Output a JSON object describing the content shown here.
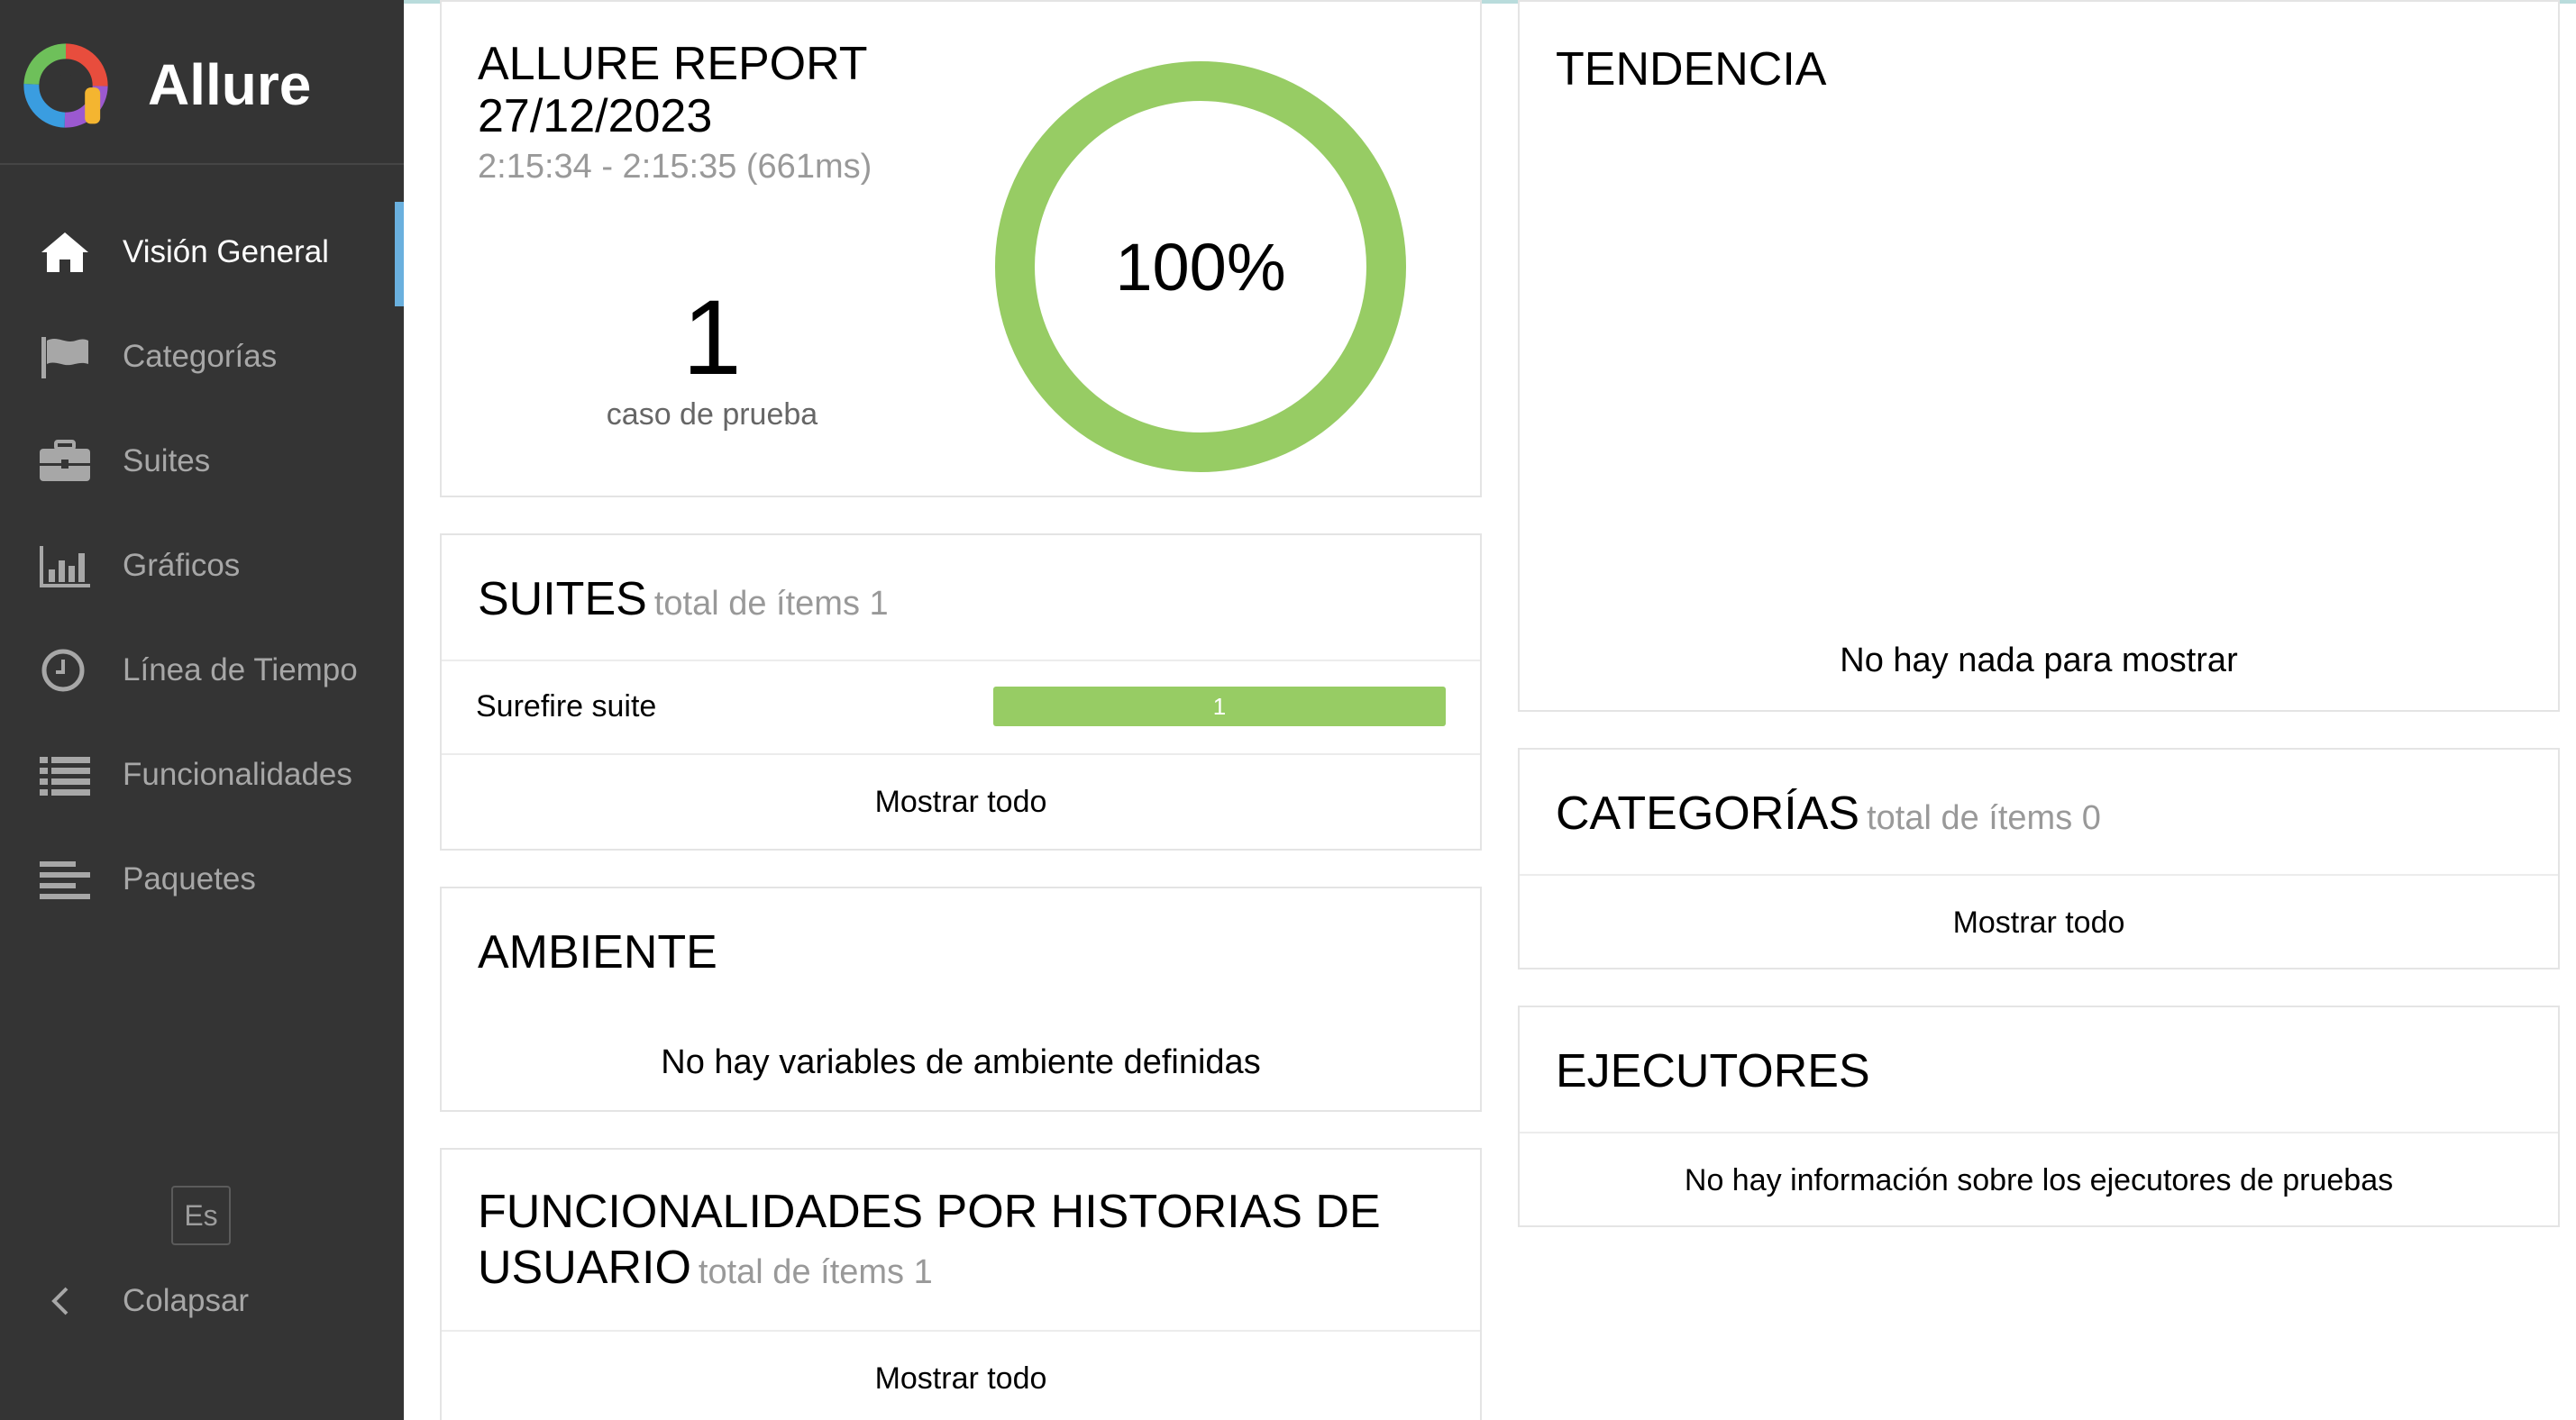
{
  "app": {
    "name": "Allure"
  },
  "sidebar": {
    "items": [
      {
        "label": "Visión General",
        "icon": "home-icon",
        "active": true
      },
      {
        "label": "Categorías",
        "icon": "flag-icon"
      },
      {
        "label": "Suites",
        "icon": "briefcase-icon"
      },
      {
        "label": "Gráficos",
        "icon": "bar-chart-icon"
      },
      {
        "label": "Línea de Tiempo",
        "icon": "clock-icon"
      },
      {
        "label": "Funcionalidades",
        "icon": "list-icon"
      },
      {
        "label": "Paquetes",
        "icon": "align-left-icon"
      }
    ],
    "language": "Es",
    "collapse_label": "Colapsar"
  },
  "report": {
    "title": "ALLURE REPORT",
    "date": "27/12/2023",
    "time_range": "2:15:34 - 2:15:35 (661ms)",
    "test_case_count": "1",
    "test_case_label": "caso de prueba",
    "success_rate": "100%",
    "success_fraction": 1.0
  },
  "trend": {
    "title": "TENDENCIA",
    "empty_text": "No hay nada para mostrar"
  },
  "suites": {
    "title": "SUITES",
    "subtitle": "total de ítems 1",
    "rows": [
      {
        "name": "Surefire suite",
        "count": "1"
      }
    ],
    "show_all": "Mostrar todo"
  },
  "categories": {
    "title": "CATEGORÍAS",
    "subtitle": "total de ítems 0",
    "show_all": "Mostrar todo"
  },
  "environment": {
    "title": "AMBIENTE",
    "empty_text": "No hay variables de ambiente definidas"
  },
  "executors": {
    "title": "EJECUTORES",
    "empty_text": "No hay información sobre los ejecutores de pruebas"
  },
  "features": {
    "title_line1": "FUNCIONALIDADES POR HISTORIAS DE",
    "title_line2": "USUARIO",
    "subtitle": "total de ítems 1",
    "show_all": "Mostrar todo"
  },
  "colors": {
    "sidebar_bg": "#343434",
    "active_indicator": "#6ab0de",
    "passed": "#97cc64",
    "muted_text": "#999999"
  }
}
